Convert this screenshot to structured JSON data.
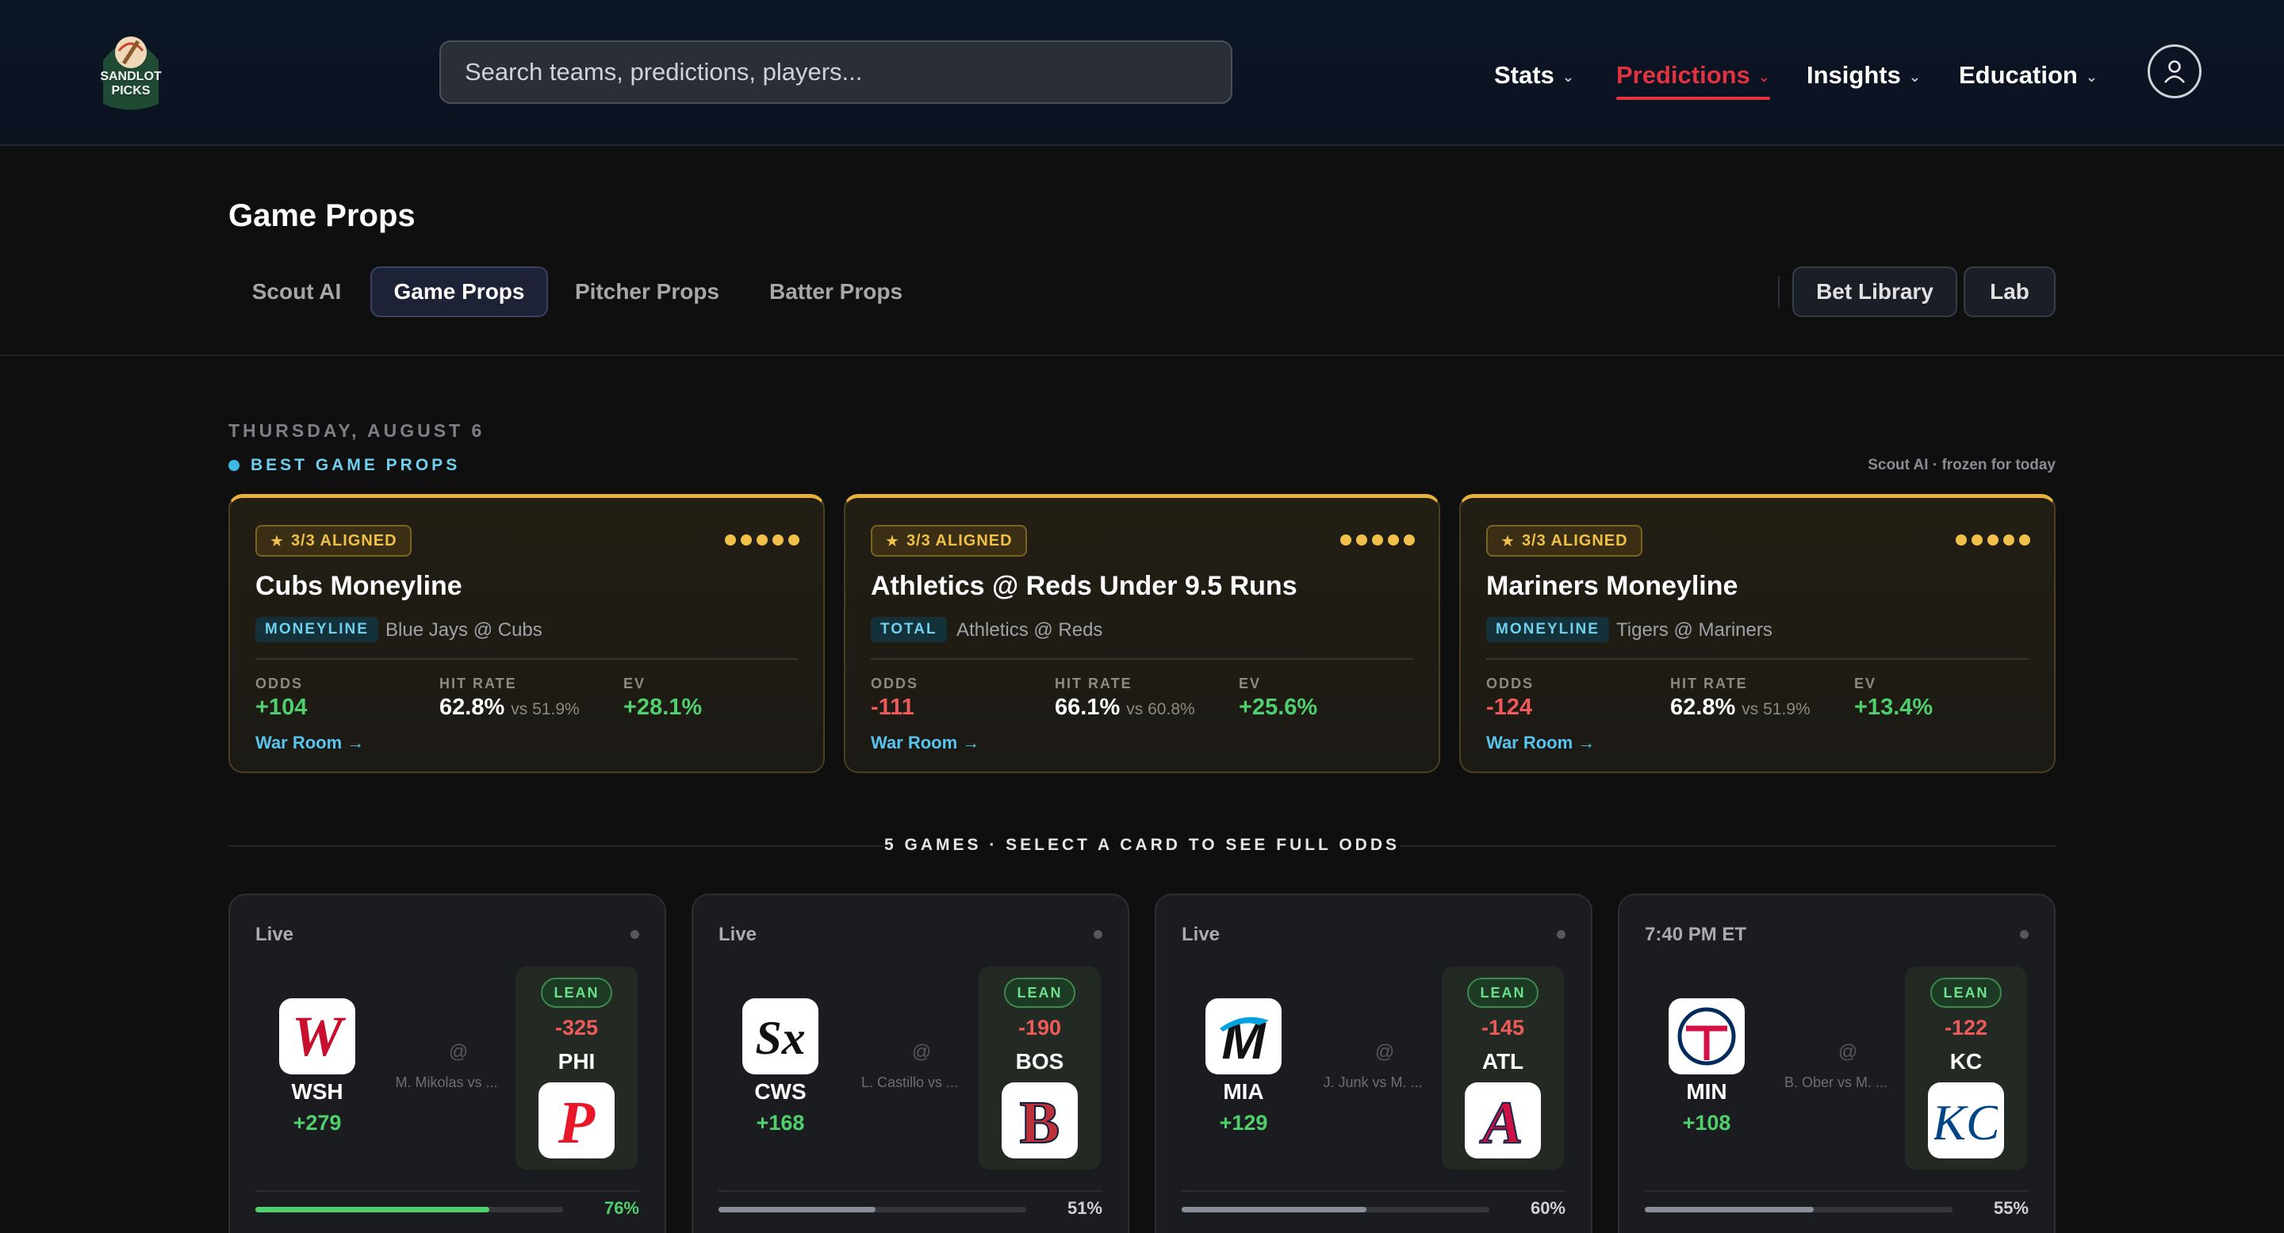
{
  "brand": {
    "logo_text": "SANDLOT\nPICKS"
  },
  "search": {
    "placeholder": "Search teams, predictions, players..."
  },
  "nav": [
    {
      "label": "Stats",
      "active": false
    },
    {
      "label": "Predictions",
      "active": true
    },
    {
      "label": "Insights",
      "active": false
    },
    {
      "label": "Education",
      "active": false
    }
  ],
  "page": {
    "title": "Game Props",
    "tabs": [
      "Scout AI",
      "Game Props",
      "Pitcher Props",
      "Batter Props"
    ],
    "active_tab": "Game Props",
    "actions": [
      "Bet Library",
      "Lab"
    ]
  },
  "date": "THURSDAY, AUGUST 6",
  "best_section": {
    "label": "BEST GAME PROPS",
    "note": "Scout AI · frozen for today"
  },
  "props": [
    {
      "badge": "3/3 ALIGNED",
      "title": "Cubs Moneyline",
      "type": "MONEYLINE",
      "matchup": "Blue Jays @ Cubs",
      "odds_label": "ODDS",
      "odds": "+104",
      "hit_label": "HIT RATE",
      "hit": "62.8%",
      "hit_vs": "vs 51.9%",
      "ev_label": "EV",
      "ev": "+28.1%",
      "link": "War Room →"
    },
    {
      "badge": "3/3 ALIGNED",
      "title": "Athletics @ Reds Under 9.5 Runs",
      "type": "TOTAL",
      "matchup": "Athletics @ Reds",
      "odds_label": "ODDS",
      "odds": "-111",
      "hit_label": "HIT RATE",
      "hit": "66.1%",
      "hit_vs": "vs 60.8%",
      "ev_label": "EV",
      "ev": "+25.6%",
      "link": "War Room →"
    },
    {
      "badge": "3/3 ALIGNED",
      "title": "Mariners Moneyline",
      "type": "MONEYLINE",
      "matchup": "Tigers @ Mariners",
      "odds_label": "ODDS",
      "odds": "-124",
      "hit_label": "HIT RATE",
      "hit": "62.8%",
      "hit_vs": "vs 51.9%",
      "ev_label": "EV",
      "ev": "+13.4%",
      "link": "War Room →"
    }
  ],
  "games_section": {
    "label": "5 GAMES · SELECT A CARD TO SEE FULL ODDS"
  },
  "games": [
    {
      "status": "Live",
      "away": "WSH",
      "away_odds": "+279",
      "at": "@",
      "pitchers": "M. Mikolas vs ...",
      "lean": "LEAN",
      "home_odds": "-325",
      "home": "PHI",
      "pct": "76%",
      "pct_value": 76,
      "bar_color": "#4fd06c",
      "pct_color": "#4fd06c"
    },
    {
      "status": "Live",
      "away": "CWS",
      "away_odds": "+168",
      "at": "@",
      "pitchers": "L. Castillo vs ...",
      "lean": "LEAN",
      "home_odds": "-190",
      "home": "BOS",
      "pct": "51%",
      "pct_value": 51,
      "bar_color": "#8a8f9b",
      "pct_color": "#cfd2d6"
    },
    {
      "status": "Live",
      "away": "MIA",
      "away_odds": "+129",
      "at": "@",
      "pitchers": "J. Junk vs M. ...",
      "lean": "LEAN",
      "home_odds": "-145",
      "home": "ATL",
      "pct": "60%",
      "pct_value": 60,
      "bar_color": "#8a8f9b",
      "pct_color": "#cfd2d6"
    },
    {
      "status": "7:40 PM ET",
      "away": "MIN",
      "away_odds": "+108",
      "at": "@",
      "pitchers": "B. Ober vs M. ...",
      "lean": "LEAN",
      "home_odds": "-122",
      "home": "KC",
      "pct": "55%",
      "pct_value": 55,
      "bar_color": "#8a8f9b",
      "pct_color": "#cfd2d6"
    }
  ]
}
